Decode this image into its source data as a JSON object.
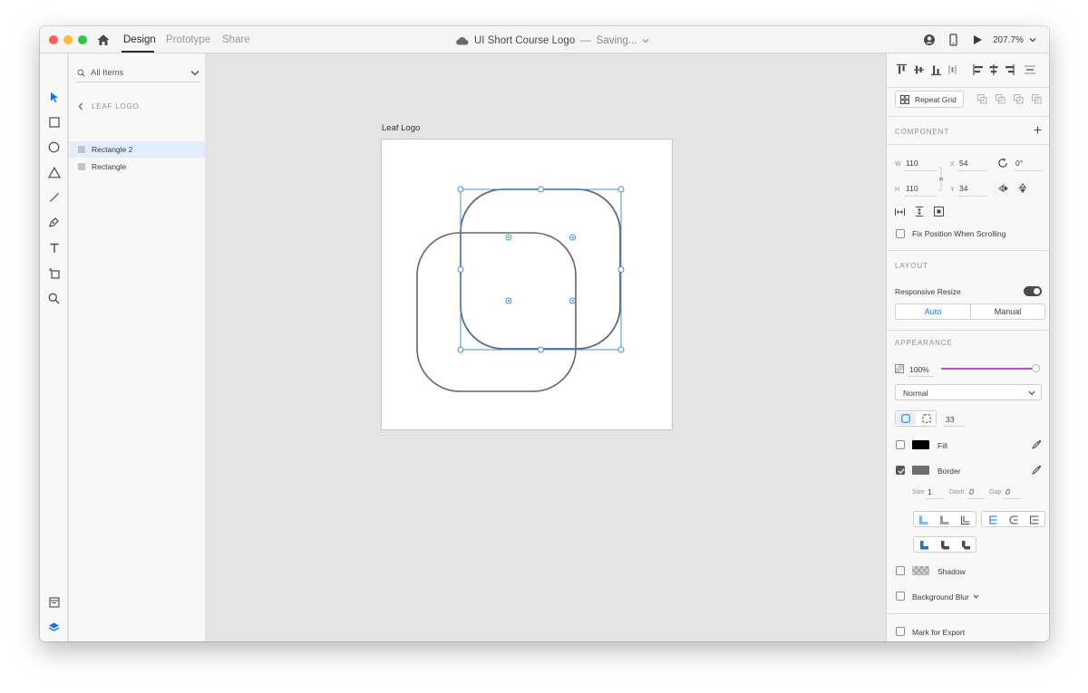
{
  "app": {
    "tabs": [
      {
        "label": "Design"
      },
      {
        "label": "Prototype"
      },
      {
        "label": "Share"
      }
    ],
    "doc_title": "UI Short Course Logo",
    "doc_separator": "—",
    "doc_status": "Saving...",
    "zoom": "207.7%"
  },
  "layers": {
    "filter_label": "All Items",
    "breadcrumb": "LEAF LOGO",
    "items": [
      {
        "label": "Rectangle 2",
        "selected": true
      },
      {
        "label": "Rectangle",
        "selected": false
      }
    ]
  },
  "canvas": {
    "artboard_title": "Leaf Logo"
  },
  "props": {
    "repeat_grid": "Repeat Grid",
    "component_title": "COMPONENT",
    "w_key": "W",
    "w": "110",
    "h_key": "H",
    "h": "110",
    "x_key": "X",
    "x": "54",
    "y_key": "Y",
    "y": "34",
    "rotation": "0°",
    "fix_position": "Fix Position When Scrolling",
    "layout_title": "LAYOUT",
    "responsive_resize": "Responsive Resize",
    "responsive_on": true,
    "auto_label": "Auto",
    "manual_label": "Manual",
    "appearance_title": "APPEARANCE",
    "opacity": "100%",
    "blend_mode": "Normal",
    "corner_radius": "33",
    "fill_label": "Fill",
    "fill_checked": false,
    "fill_color": "#000000",
    "border_label": "Border",
    "border_checked": true,
    "border_color": "#6e6e6e",
    "size_key": "Size",
    "size_val": "1",
    "dash_key": "Dash",
    "dash_val": "0",
    "gap_key": "Gap",
    "gap_val": "0",
    "shadow_label": "Shadow",
    "blur_label": "Background Blur",
    "export_label": "Mark for Export"
  },
  "colors": {
    "accent": "#1473e6",
    "selection": "#4a90e2",
    "opacity_slider": "#b552c4"
  },
  "icons": {
    "tools": [
      "select-arrow-icon",
      "rectangle-tool-icon",
      "ellipse-tool-icon",
      "polygon-tool-icon",
      "line-tool-icon",
      "pen-tool-icon",
      "text-tool-icon",
      "artboard-tool-icon",
      "zoom-tool-icon"
    ],
    "bottom": [
      "assets-icon",
      "layers-icon",
      "plugins-icon"
    ]
  }
}
